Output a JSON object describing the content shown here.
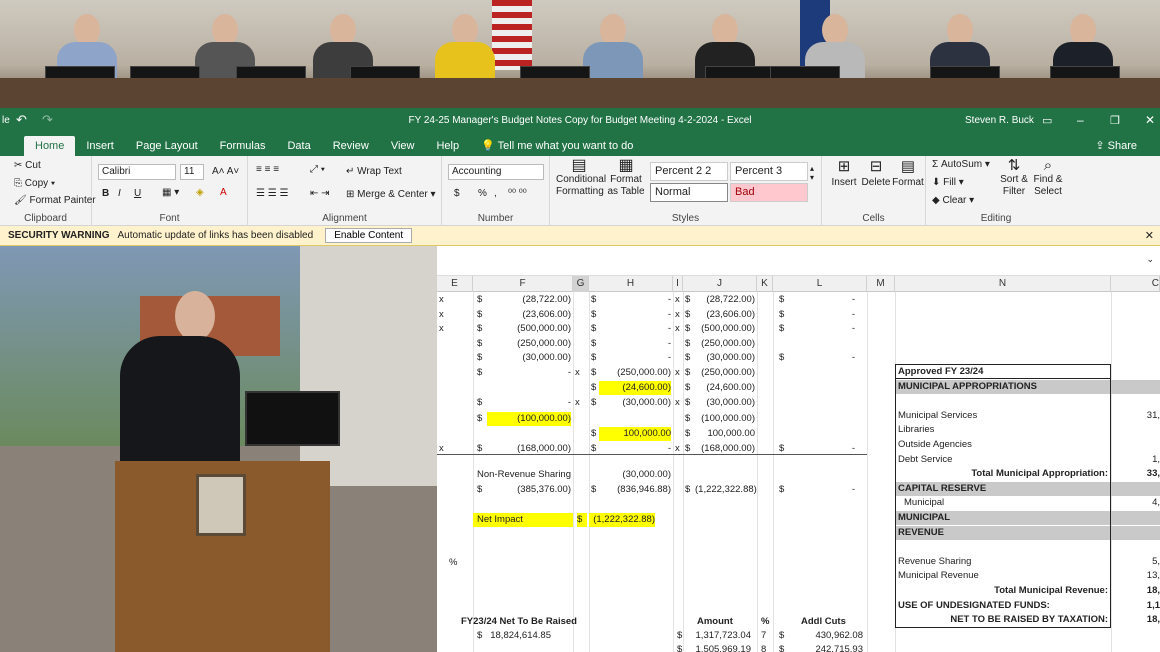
{
  "window": {
    "title": "FY 24-25 Manager's Budget Notes Copy for Budget Meeting 4-2-2024  -  Excel",
    "user": "Steven R. Buck",
    "file_stub": "le"
  },
  "qat": {
    "undo": "↶",
    "redo": "↷"
  },
  "tabs": [
    "Home",
    "Insert",
    "Page Layout",
    "Formulas",
    "Data",
    "Review",
    "View",
    "Help"
  ],
  "tellme": "Tell me what you want to do",
  "share": "Share",
  "clipboard": {
    "cut": "Cut",
    "copy": "Copy",
    "painter": "Format Painter",
    "label": "Clipboard"
  },
  "font": {
    "name": "Calibri",
    "size": "11",
    "label": "Font",
    "bold": "B",
    "italic": "I",
    "underline": "U"
  },
  "alignment": {
    "wrap": "Wrap Text",
    "merge": "Merge & Center",
    "label": "Alignment"
  },
  "number": {
    "format": "Accounting",
    "label": "Number",
    "dollar": "$",
    "pct": "%",
    "comma": ","
  },
  "styles": {
    "cond": "Conditional Formatting",
    "table": "Format as Table",
    "p22": "Percent 2 2",
    "p3": "Percent 3",
    "normal": "Normal",
    "bad": "Bad",
    "label": "Styles"
  },
  "cells": {
    "insert": "Insert",
    "delete": "Delete",
    "format": "Format",
    "label": "Cells"
  },
  "editing": {
    "autosum": "AutoSum",
    "fill": "Fill",
    "clear": "Clear",
    "sort": "Sort & Filter",
    "find": "Find & Select",
    "label": "Editing"
  },
  "security": {
    "title": "SECURITY WARNING",
    "msg": "Automatic update of links has been disabled",
    "button": "Enable Content"
  },
  "columns": [
    "E",
    "F",
    "G",
    "H",
    "I",
    "J",
    "K",
    "L",
    "M",
    "N",
    "C"
  ],
  "rows": [
    {
      "e": "x",
      "f": "(28,722.00)",
      "h": "-",
      "i": "x",
      "j": "(28,722.00)",
      "l": "-"
    },
    {
      "e": "x",
      "f": "(23,606.00)",
      "h": "-",
      "i": "x",
      "j": "(23,606.00)",
      "l": "-"
    },
    {
      "e": "x",
      "f": "(500,000.00)",
      "h": "-",
      "i": "x",
      "j": "(500,000.00)",
      "l": "-"
    },
    {
      "e": "",
      "f": "(250,000.00)",
      "h": "-",
      "i": "",
      "j": "(250,000.00)",
      "l": ""
    },
    {
      "e": "",
      "f": "(30,000.00)",
      "h": "-",
      "i": "",
      "j": "(30,000.00)",
      "l": "-"
    },
    {
      "e": "",
      "f": "-",
      "g": "x",
      "h": "(250,000.00)",
      "i": "x",
      "j": "(250,000.00)",
      "l": ""
    },
    {
      "e": "",
      "f": "",
      "h": "(24,600.00)",
      "i": "",
      "j": "(24,600.00)",
      "l": ""
    },
    {
      "e": "",
      "f": "-",
      "g": "x",
      "h": "(30,000.00)",
      "i": "x",
      "j": "(30,000.00)",
      "l": ""
    },
    {
      "e": "",
      "f": "(100,000.00)",
      "h": "",
      "i": "",
      "j": "(100,000.00)",
      "l": ""
    },
    {
      "e": "",
      "f": "",
      "h": "100,000.00",
      "i": "",
      "j": "100,000.00",
      "l": ""
    },
    {
      "e": "x",
      "f": "(168,000.00)",
      "h": "-",
      "i": "x",
      "j": "(168,000.00)",
      "l": "-"
    }
  ],
  "nonrev": {
    "label": "Non-Revenue Sharing",
    "value": "(30,000.00)"
  },
  "totals": {
    "f": "(385,376.00)",
    "h": "(836,946.88)",
    "j": "(1,222,322.88)",
    "l": "-"
  },
  "net": {
    "label": "Net Impact",
    "value": "(1,222,322.88)"
  },
  "pct": "%",
  "bottom": {
    "h1": "FY23/24 Net To Be Raised",
    "h2": "Amount",
    "h3": "%",
    "h4": "Addl Cuts",
    "r1a": "18,824,614.85",
    "r1b": "1,317,723.04",
    "r1c": "7",
    "r1d": "430,962.08",
    "r2b": "1,505,969.19",
    "r2c": "8",
    "r2d": "242,715.93"
  },
  "summary": [
    {
      "n": "Approved FY 23/24",
      "c": "",
      "style": "title"
    },
    {
      "n": "MUNICIPAL APPROPRIATIONS",
      "c": "",
      "style": "band"
    },
    {
      "n": "",
      "c": "",
      "style": ""
    },
    {
      "n": "Municipal Services",
      "c": "31,",
      "style": ""
    },
    {
      "n": "Libraries",
      "c": "",
      "style": ""
    },
    {
      "n": "Outside Agencies",
      "c": "",
      "style": ""
    },
    {
      "n": "Debt Service",
      "c": "1,",
      "style": ""
    },
    {
      "n": "Total Municipal Appropriation:",
      "c": "33,",
      "style": "tot"
    },
    {
      "n": "CAPITAL RESERVE",
      "c": "",
      "style": "band"
    },
    {
      "n": "Municipal",
      "c": "4,",
      "style": "ind"
    },
    {
      "n": "MUNICIPAL",
      "c": "",
      "style": "band"
    },
    {
      "n": "REVENUE",
      "c": "",
      "style": "band"
    },
    {
      "n": "",
      "c": "",
      "style": ""
    },
    {
      "n": "Revenue Sharing",
      "c": "5,",
      "style": ""
    },
    {
      "n": "Municipal Revenue",
      "c": "13,",
      "style": ""
    },
    {
      "n": "Total Municipal Revenue:",
      "c": "18,",
      "style": "tot"
    },
    {
      "n": "USE OF UNDESIGNATED FUNDS:",
      "c": "1,1",
      "style": "bold"
    },
    {
      "n": "NET TO BE RAISED BY TAXATION:",
      "c": "18,",
      "style": "totb"
    }
  ],
  "colors": {
    "excel_green": "#217346",
    "yellow": "#ffff00",
    "band": "#c9c9c9",
    "bad": "#ffc7ce"
  }
}
